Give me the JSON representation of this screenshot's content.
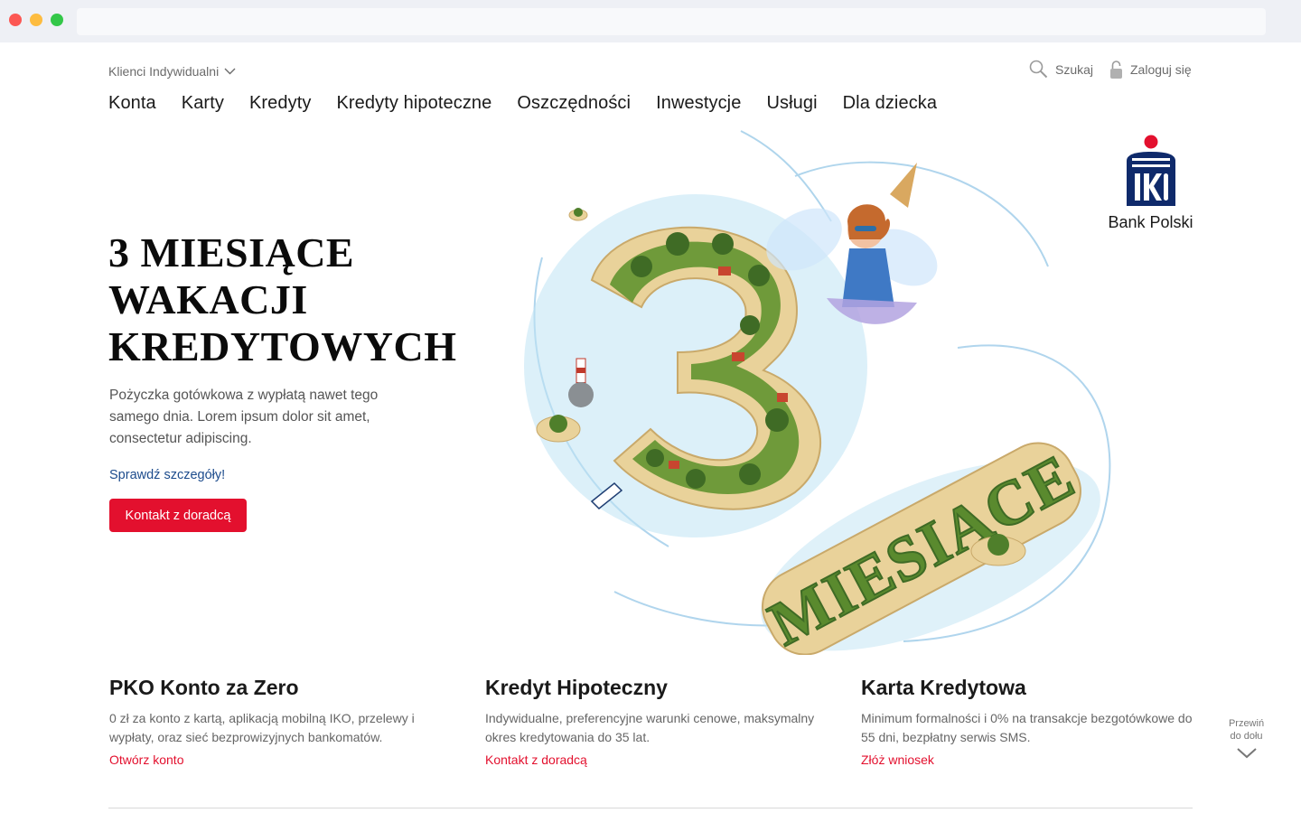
{
  "header": {
    "segment_label": "Klienci Indywidualni",
    "search_label": "Szukaj",
    "login_label": "Zaloguj się"
  },
  "nav": {
    "items": [
      "Konta",
      "Karty",
      "Kredyty",
      "Kredyty hipoteczne",
      "Oszczędności",
      "Inwestycje",
      "Usługi",
      "Dla dziecka"
    ]
  },
  "logo": {
    "mark_text": "PKO",
    "name": "Bank Polski"
  },
  "hero": {
    "title_lines": [
      "3 MIESIĄCE",
      "WAKACJI",
      "KREDYTOWYCH"
    ],
    "description": "Pożyczka gotówkowa z wypłatą nawet tego samego dnia. Lorem ipsum dolor sit amet, consectetur adipiscing.",
    "details_link": "Sprawdź szczegóły!",
    "cta_label": "Kontakt z doradcą",
    "illustration_word": "MIESIĄCE",
    "illustration_numeral": "3"
  },
  "cards": [
    {
      "title": "PKO Konto za Zero",
      "description": "0 zł za konto z kartą, aplikacją mobilną IKO, przelewy i wypłaty, oraz sieć bezprowizyjnych bankomatów.",
      "link": "Otwórz konto"
    },
    {
      "title": "Kredyt Hipoteczny",
      "description": "Indywidualne, preferencyjne warunki cenowe, maksymalny okres kredytowania do 35 lat.",
      "link": "Kontakt z doradcą"
    },
    {
      "title": "Karta Kredytowa",
      "description": "Minimum formalności i 0% na transakcje bezgotówkowe do 55 dni, bezpłatny serwis SMS.",
      "link": "Złóż wniosek"
    }
  ],
  "scroll_hint": {
    "line1": "Przewiń",
    "line2": "do dołu"
  },
  "colors": {
    "brand_red": "#e3102e",
    "brand_navy": "#0f2a6b",
    "link_blue": "#1c4b8c"
  }
}
